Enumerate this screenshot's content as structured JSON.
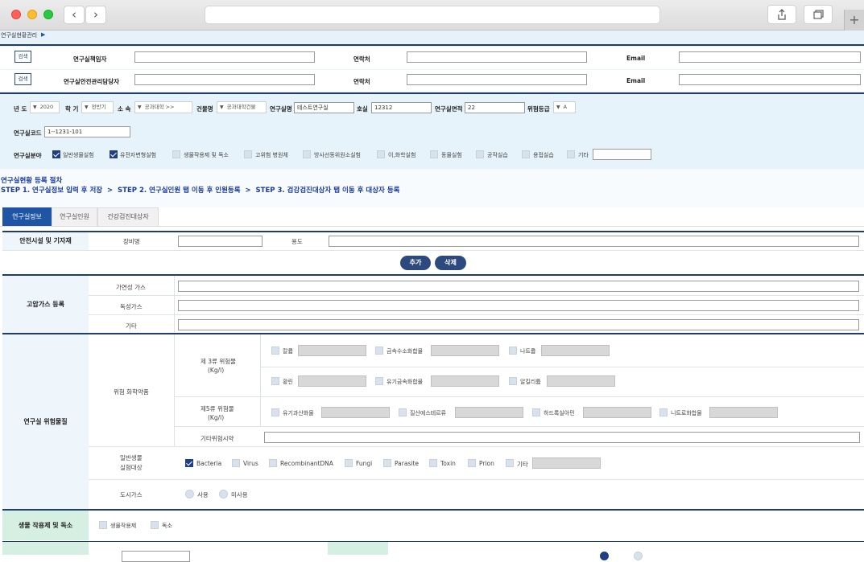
{
  "browser": {
    "back_icon": "‹",
    "forward_icon": "›",
    "share_icon": "share-icon",
    "tabs_icon": "tabs-icon",
    "new_tab": "+"
  },
  "breadcrumb": {
    "label": "연구실현황관리",
    "arrow": "▶"
  },
  "people": {
    "search_label": "검색",
    "manager_label": "연구실책임자",
    "safety_label": "연구실안전관리담당자",
    "contact_label": "연락처",
    "email_label": "Email"
  },
  "filters": {
    "year_label": "년 도",
    "year_value": "2020",
    "semester_label": "학 기",
    "semester_value": "전반기",
    "dept_label": "소 속",
    "dept_value": "공과대학 >>",
    "building_label": "건물명",
    "building_value": "공과대학건물",
    "lab_label": "연구실명",
    "lab_value": "테스트연구실",
    "room_label": "호실",
    "room_value": "12312",
    "area_label": "연구실면적",
    "area_value": "22",
    "risk_label": "위험등급",
    "risk_value": "A",
    "code_label": "연구실코드",
    "code_value": "1--1231-101",
    "field_label": "연구실분야",
    "fields": [
      "일반생물실험",
      "유전자변형실험",
      "생물작용제 및 독소",
      "고위험 병원체",
      "방사선동위원소실험",
      "이,화학실험",
      "동물실험",
      "공작실습",
      "용접실습",
      "기타"
    ]
  },
  "steps": {
    "title": "연구실현황 등록 절차",
    "line": "STEP 1. 연구실정보 입력 후 저장  >  STEP 2. 연구실인원 탭 이동 후 인원등록  >  STEP 3. 검강검진대상자 탭 이동 후 대상자 등록"
  },
  "tabs": [
    "연구실정보",
    "연구실인원",
    "건강검진대상자"
  ],
  "safety": {
    "section_label": "안전시설 및 기자재",
    "equip_label": "장비명",
    "use_label": "용도",
    "add_button": "추가",
    "delete_button": "삭제"
  },
  "gas": {
    "section_label": "고압가스 등록",
    "rows": [
      "가연성 가스",
      "독성가스",
      "기타"
    ]
  },
  "hazard": {
    "section_label": "연구실 위험물질",
    "chem_label": "위험 화학약품",
    "class3_label1": "제 3류 위험물",
    "class3_label2": "(Kg/l)",
    "class3_items": [
      "칼륨",
      "금속수소화합물",
      "나트륨",
      "황린",
      "유기금속화합물",
      "알킬리튬"
    ],
    "class5_label1": "제5류 위험물",
    "class5_label2": "(Kg/l)",
    "class5_items": [
      "유기과산화물",
      "질산에스테르류",
      "하드록실아민",
      "니트로화합물"
    ],
    "other_reagent_label": "기타위험시약",
    "bio_label1": "일반생물",
    "bio_label2": "실험대상",
    "bio_items": [
      "Bacteria",
      "Virus",
      "RecombinantDNA",
      "Fungi",
      "Parasite",
      "Toxin",
      "Prion",
      "기타"
    ],
    "city_gas_label": "도시가스",
    "use_option": "사용",
    "nonuse_option": "미사용"
  },
  "bio_agent": {
    "section_label": "생물 작용제 및 독소",
    "items": [
      "생물작용제",
      "독소"
    ]
  }
}
